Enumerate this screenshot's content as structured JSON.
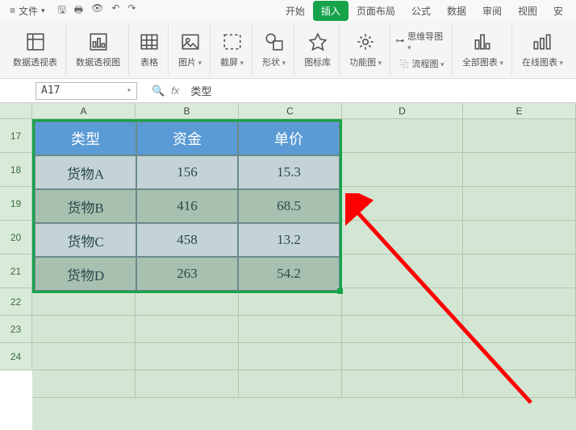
{
  "menubar": {
    "file_label": "文件",
    "tabs": {
      "start": "开始",
      "insert": "插入",
      "layout": "页面布局",
      "formula": "公式",
      "data": "数据",
      "review": "审阅",
      "view": "视图",
      "more": "安"
    },
    "active_tab": "insert"
  },
  "ribbon": {
    "pivot_table": "数据透视表",
    "pivot_chart": "数据透视图",
    "table": "表格",
    "picture": "图片",
    "screenshot": "截屏",
    "shapes": "形状",
    "icon_lib": "图标库",
    "feature_chart": "功能图",
    "mindmap": "思维导图",
    "flowchart": "流程图",
    "all_charts": "全部图表",
    "online_chart": "在线图表",
    "more": "…"
  },
  "fxbar": {
    "namebox": "A17",
    "formula_value": "类型"
  },
  "columns": {
    "A": "A",
    "B": "B",
    "C": "C",
    "D": "D",
    "E": "E"
  },
  "row_numbers": [
    "17",
    "18",
    "19",
    "20",
    "21",
    "22",
    "23",
    "24"
  ],
  "table": {
    "headers": {
      "type": "类型",
      "fund": "资金",
      "price": "单价"
    },
    "rows": [
      {
        "type": "货物A",
        "fund": "156",
        "price": "15.3"
      },
      {
        "type": "货物B",
        "fund": "416",
        "price": "68.5"
      },
      {
        "type": "货物C",
        "fund": "458",
        "price": "13.2"
      },
      {
        "type": "货物D",
        "fund": "263",
        "price": "54.2"
      }
    ]
  }
}
